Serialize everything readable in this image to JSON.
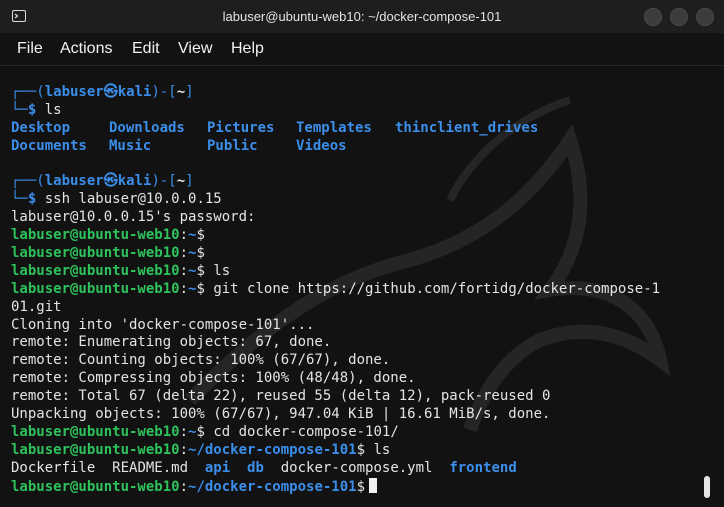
{
  "window": {
    "title": "labuser@ubuntu-web10: ~/docker-compose-101"
  },
  "menu": [
    "File",
    "Actions",
    "Edit",
    "View",
    "Help"
  ],
  "colors": {
    "background": "#121212",
    "prompt_user": "#2ec25c",
    "path": "#3b8eea",
    "directory": "#3b8eea"
  },
  "kali": {
    "open1": "┌──(",
    "user": "labuser",
    "sym": "㉿",
    "host": "kali",
    "close1": ")-[",
    "dir": "~",
    "close2": "]",
    "branch": "└─",
    "dollar": "$"
  },
  "cmd1": "ls",
  "ls1": {
    "row1": [
      "Desktop",
      "Downloads",
      "Pictures",
      "Templates",
      "thinclient_drives"
    ],
    "row2": [
      "Documents",
      "Music",
      "Public",
      "Videos"
    ]
  },
  "cmd2": "ssh labuser@10.0.0.15",
  "password_prompt": "labuser@10.0.0.15's password:",
  "remote": {
    "user_host": "labuser@ubuntu-web10",
    "colon": ":",
    "home": "~",
    "project": "~/docker-compose-101",
    "dollar": "$"
  },
  "cmd3": "ls",
  "cmd4": "git clone https://github.com/fortidg/docker-compose-1",
  "cmd4_wrap": "01.git",
  "clone_output": [
    "Cloning into 'docker-compose-101'...",
    "remote: Enumerating objects: 67, done.",
    "remote: Counting objects: 100% (67/67), done.",
    "remote: Compressing objects: 100% (48/48), done.",
    "remote: Total 67 (delta 22), reused 55 (delta 12), pack-reused 0",
    "Unpacking objects: 100% (67/67), 947.04 KiB | 16.61 MiB/s, done."
  ],
  "cmd5": "cd docker-compose-101/",
  "cmd6": "ls",
  "ls2": {
    "f1": "Dockerfile",
    "f2": "README.md",
    "d1": "api",
    "d2": "db",
    "f3": "docker-compose.yml",
    "d3": "frontend"
  }
}
